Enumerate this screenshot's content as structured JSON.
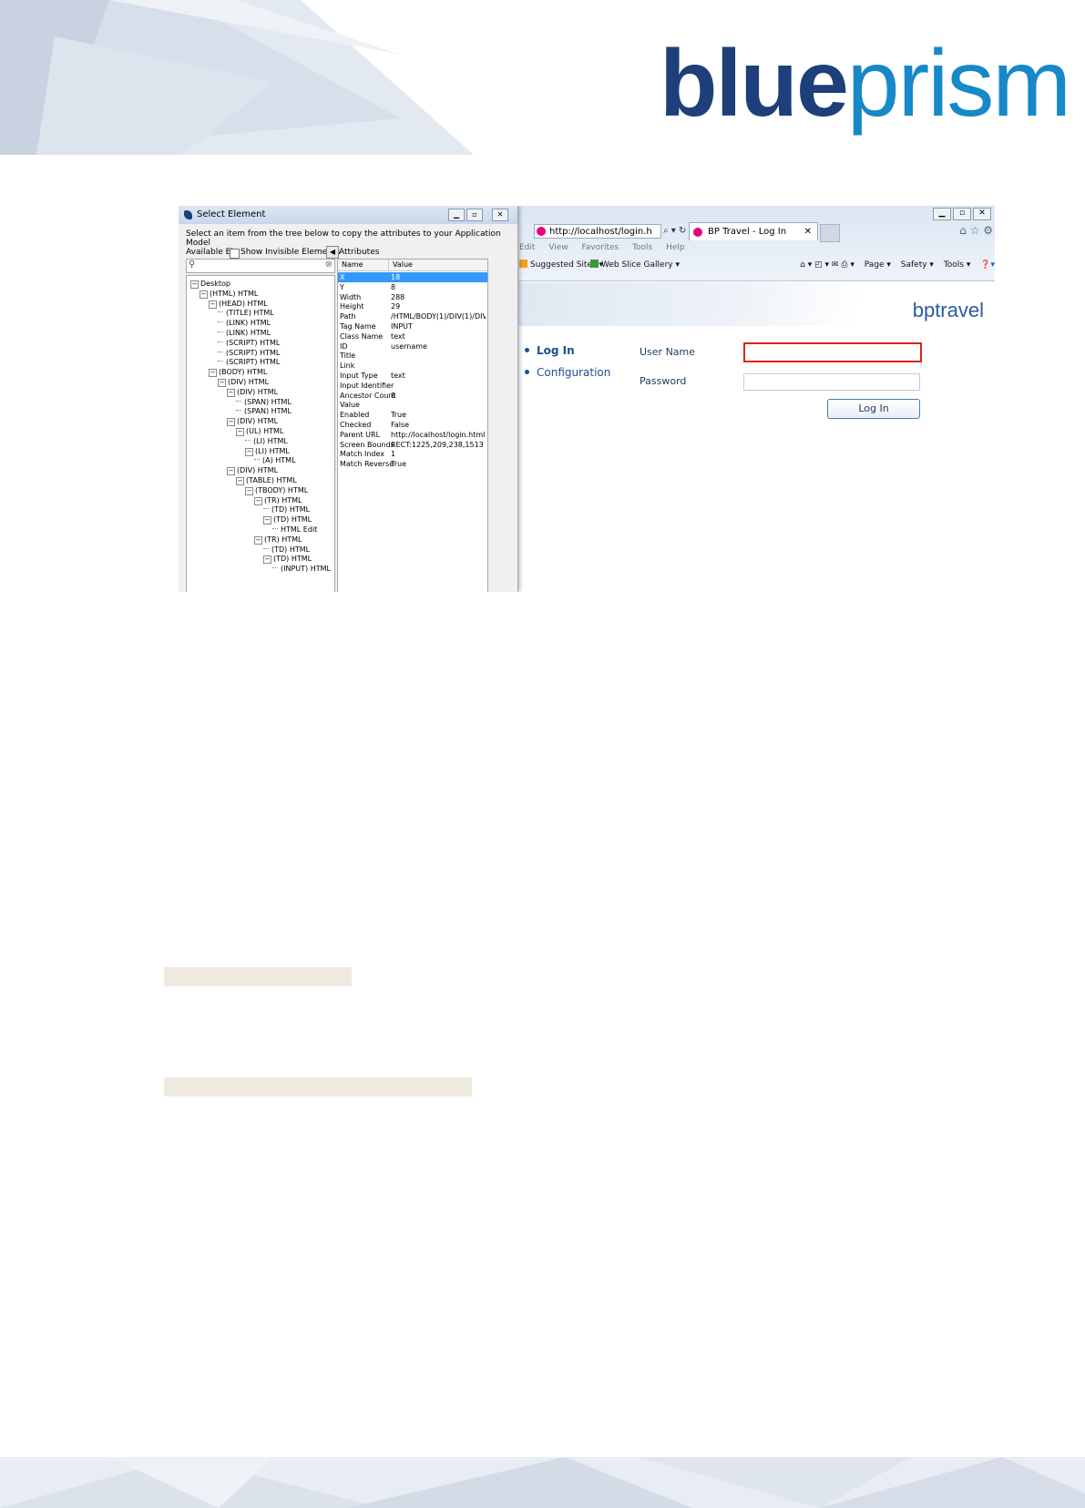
{
  "brand": {
    "logo_part1": "blue",
    "logo_part2": "prism",
    "primary": "#1d3f7a",
    "secondary": "#1788c8"
  },
  "dialog": {
    "title": "Select Element",
    "instruction": "Select an item from the tree below to copy the attributes to your Application Model",
    "available_label": "Available Ele",
    "show_invisible": "Show Invisible Elements",
    "attributes_label": "Attributes",
    "attr_headers": {
      "name": "Name",
      "value": "Value"
    },
    "attributes": [
      {
        "name": "X",
        "value": "18"
      },
      {
        "name": "Y",
        "value": "8"
      },
      {
        "name": "Width",
        "value": "288"
      },
      {
        "name": "Height",
        "value": "29"
      },
      {
        "name": "Path",
        "value": "/HTML/BODY(1)/DIV(1)/DIV(3..."
      },
      {
        "name": "Tag Name",
        "value": "INPUT"
      },
      {
        "name": "Class Name",
        "value": "text"
      },
      {
        "name": "ID",
        "value": "username"
      },
      {
        "name": "Title",
        "value": ""
      },
      {
        "name": "Link",
        "value": ""
      },
      {
        "name": "Input Type",
        "value": "text"
      },
      {
        "name": "Input Identifier",
        "value": ""
      },
      {
        "name": "Ancestor Count",
        "value": "8"
      },
      {
        "name": "Value",
        "value": ""
      },
      {
        "name": "Enabled",
        "value": "True"
      },
      {
        "name": "Checked",
        "value": "False"
      },
      {
        "name": "Parent URL",
        "value": "http://localhost/login.html"
      },
      {
        "name": "Screen Bounds",
        "value": "RECT:1225,209,238,1513"
      },
      {
        "name": "Match Index",
        "value": "1"
      },
      {
        "name": "Match Reverse",
        "value": "True"
      }
    ],
    "tree": [
      {
        "label": "Desktop",
        "depth": 0,
        "exp": true
      },
      {
        "label": "(HTML) HTML",
        "depth": 1,
        "exp": true
      },
      {
        "label": "(HEAD) HTML",
        "depth": 2,
        "exp": true
      },
      {
        "label": "(TITLE) HTML",
        "depth": 3,
        "exp": false
      },
      {
        "label": "(LINK) HTML",
        "depth": 3,
        "exp": false
      },
      {
        "label": "(LINK) HTML",
        "depth": 3,
        "exp": false
      },
      {
        "label": "(SCRIPT) HTML",
        "depth": 3,
        "exp": false
      },
      {
        "label": "(SCRIPT) HTML",
        "depth": 3,
        "exp": false
      },
      {
        "label": "(SCRIPT) HTML",
        "depth": 3,
        "exp": false
      },
      {
        "label": "(BODY) HTML",
        "depth": 2,
        "exp": true
      },
      {
        "label": "(DIV) HTML",
        "depth": 3,
        "exp": true
      },
      {
        "label": "(DIV) HTML",
        "depth": 4,
        "exp": true
      },
      {
        "label": "(SPAN) HTML",
        "depth": 5,
        "exp": false
      },
      {
        "label": "(SPAN) HTML",
        "depth": 5,
        "exp": false
      },
      {
        "label": "(DIV) HTML",
        "depth": 4,
        "exp": true
      },
      {
        "label": "(UL) HTML",
        "depth": 5,
        "exp": true
      },
      {
        "label": "(LI) HTML",
        "depth": 6,
        "exp": false
      },
      {
        "label": "(LI) HTML",
        "depth": 6,
        "exp": true
      },
      {
        "label": "(A) HTML",
        "depth": 7,
        "exp": false
      },
      {
        "label": "(DIV) HTML",
        "depth": 4,
        "exp": true
      },
      {
        "label": "(TABLE) HTML",
        "depth": 5,
        "exp": true
      },
      {
        "label": "(TBODY) HTML",
        "depth": 6,
        "exp": true
      },
      {
        "label": "(TR) HTML",
        "depth": 7,
        "exp": true
      },
      {
        "label": "(TD) HTML",
        "depth": 8,
        "exp": false
      },
      {
        "label": "(TD) HTML",
        "depth": 8,
        "exp": true
      },
      {
        "label": "HTML Edit",
        "depth": 9,
        "exp": false
      },
      {
        "label": "(TR) HTML",
        "depth": 7,
        "exp": true
      },
      {
        "label": "(TD) HTML",
        "depth": 8,
        "exp": false
      },
      {
        "label": "(TD) HTML",
        "depth": 8,
        "exp": true
      },
      {
        "label": "(INPUT) HTML",
        "depth": 9,
        "exp": false
      }
    ]
  },
  "browser": {
    "address": "http://localhost/login.h",
    "tab_title": "BP Travel - Log In",
    "menu": [
      "Edit",
      "View",
      "Favorites",
      "Tools",
      "Help"
    ],
    "favorites": [
      "Suggested Sites ▾",
      "Web Slice Gallery ▾"
    ],
    "commands": [
      "Page ▾",
      "Safety ▾",
      "Tools ▾"
    ]
  },
  "site": {
    "brand": "bptravel",
    "nav": [
      "Log In",
      "Configuration"
    ],
    "username_label": "User Name",
    "password_label": "Password",
    "login_button": "Log In"
  }
}
